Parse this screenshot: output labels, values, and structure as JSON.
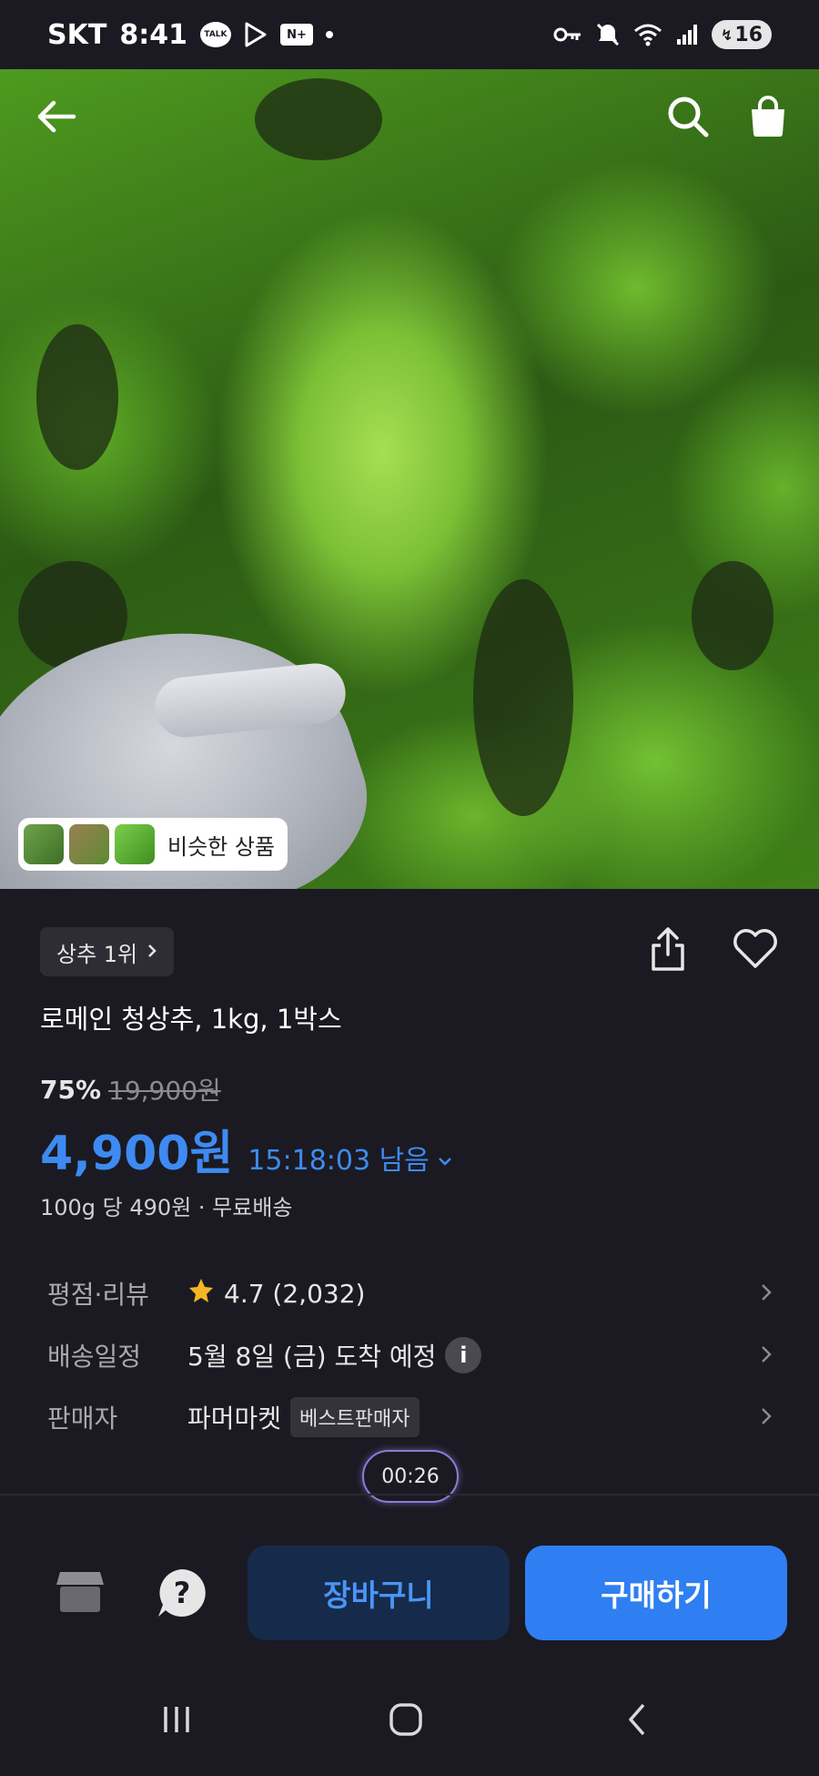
{
  "status_bar": {
    "carrier": "SKT",
    "time": "8:41",
    "talk_label": "TALK",
    "nplus_label": "N+",
    "battery": "16",
    "icons": [
      "talk-icon",
      "play-store-icon",
      "naver-plus-icon",
      "key-icon",
      "mute-icon",
      "wifi-icon",
      "signal-icon",
      "battery-icon"
    ]
  },
  "hero": {
    "icons": [
      "back-arrow-icon",
      "search-icon",
      "shopping-bag-icon"
    ],
    "similar_label": "비슷한 상품"
  },
  "product": {
    "rank_label": "상추 1위",
    "title": "로메인 청상추, 1kg, 1박스",
    "discount": "75%",
    "original_price": "19,900원",
    "price": "4,900원",
    "timer": "15:18:03 남음",
    "unit_price": "100g 당 490원 · 무료배송"
  },
  "info": {
    "rating_label": "평점·리뷰",
    "rating_value": "4.7 (2,032)",
    "delivery_label": "배송일정",
    "delivery_value": "5월 8일 (금) 도착 예정",
    "delivery_info": "i",
    "seller_label": "판매자",
    "seller_name": "파머마켓",
    "seller_badge": "베스트판매자"
  },
  "video": {
    "time": "00:26"
  },
  "actions": {
    "help": "?",
    "cart_label": "장바구니",
    "buy_label": "구매하기"
  },
  "colors": {
    "background": "#1b1a22",
    "accent_blue": "#3d8bf2",
    "buy_button": "#2f7ff2",
    "cart_button": "#162a4b",
    "star": "#f5b526"
  }
}
